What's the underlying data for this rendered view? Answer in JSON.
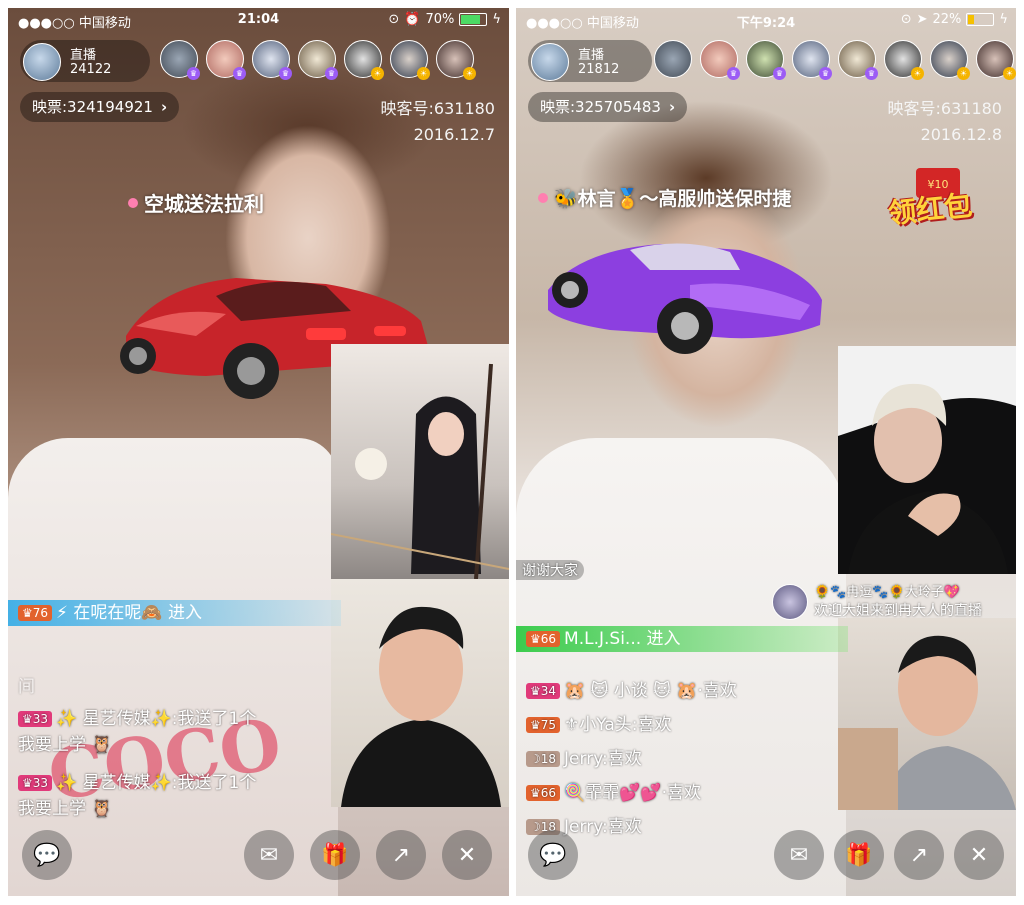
{
  "left": {
    "status": {
      "carrier": "●●●○○ 中国移动",
      "time": "21:04",
      "battery": "70%",
      "battery_level": 0.7
    },
    "host": {
      "label": "直播",
      "count": "24122"
    },
    "ticket": "映票:324194921",
    "room_id": "映客号:631180",
    "date": "2016.12.7",
    "gift_message": "空城送法拉利",
    "entry": {
      "level": "76",
      "text": "⚡ 在呢在呢🙈 进入"
    },
    "chat_line_faded": "间",
    "chats": [
      {
        "level": "33",
        "name": "✨ 星艺传媒✨:",
        "text": "我送了1个",
        "text2": "我要上学"
      },
      {
        "level": "33",
        "name": "✨ 星艺传媒✨:",
        "text": "我送了1个",
        "text2": "我要上学"
      }
    ]
  },
  "right": {
    "status": {
      "carrier": "●●●○○ 中国移动",
      "time": "下午9:24",
      "battery": "22%",
      "battery_level": 0.22
    },
    "host": {
      "label": "直播",
      "count": "21812"
    },
    "ticket": "映票:325705483",
    "room_id": "映客号:631180",
    "date": "2016.12.8",
    "gift_message": "🐝林言🏅～高服帅送保时捷",
    "red_packet": "领红包",
    "thanks": "谢谢大家",
    "pip_comment": {
      "name": "🌻🐾冉逗🐾🌻大玲子💖",
      "text": "欢迎大姐来到冉大人的直播"
    },
    "entry": {
      "level": "66",
      "text": "M.L.J.Si... 进入"
    },
    "chats": [
      {
        "level": "34",
        "name": "🐹 🐱 小谈 🐱 🐹",
        "text": "·喜欢"
      },
      {
        "level": "75",
        "name": "⚜小Ya头:",
        "text": "喜欢"
      },
      {
        "level": "18",
        "name": "Jerry:",
        "text": "喜欢"
      },
      {
        "level": "66",
        "name": "🍭霏霏💕💕",
        "text": "·喜欢"
      },
      {
        "level": "18",
        "name": "Jerry:",
        "text": "喜欢"
      }
    ]
  }
}
